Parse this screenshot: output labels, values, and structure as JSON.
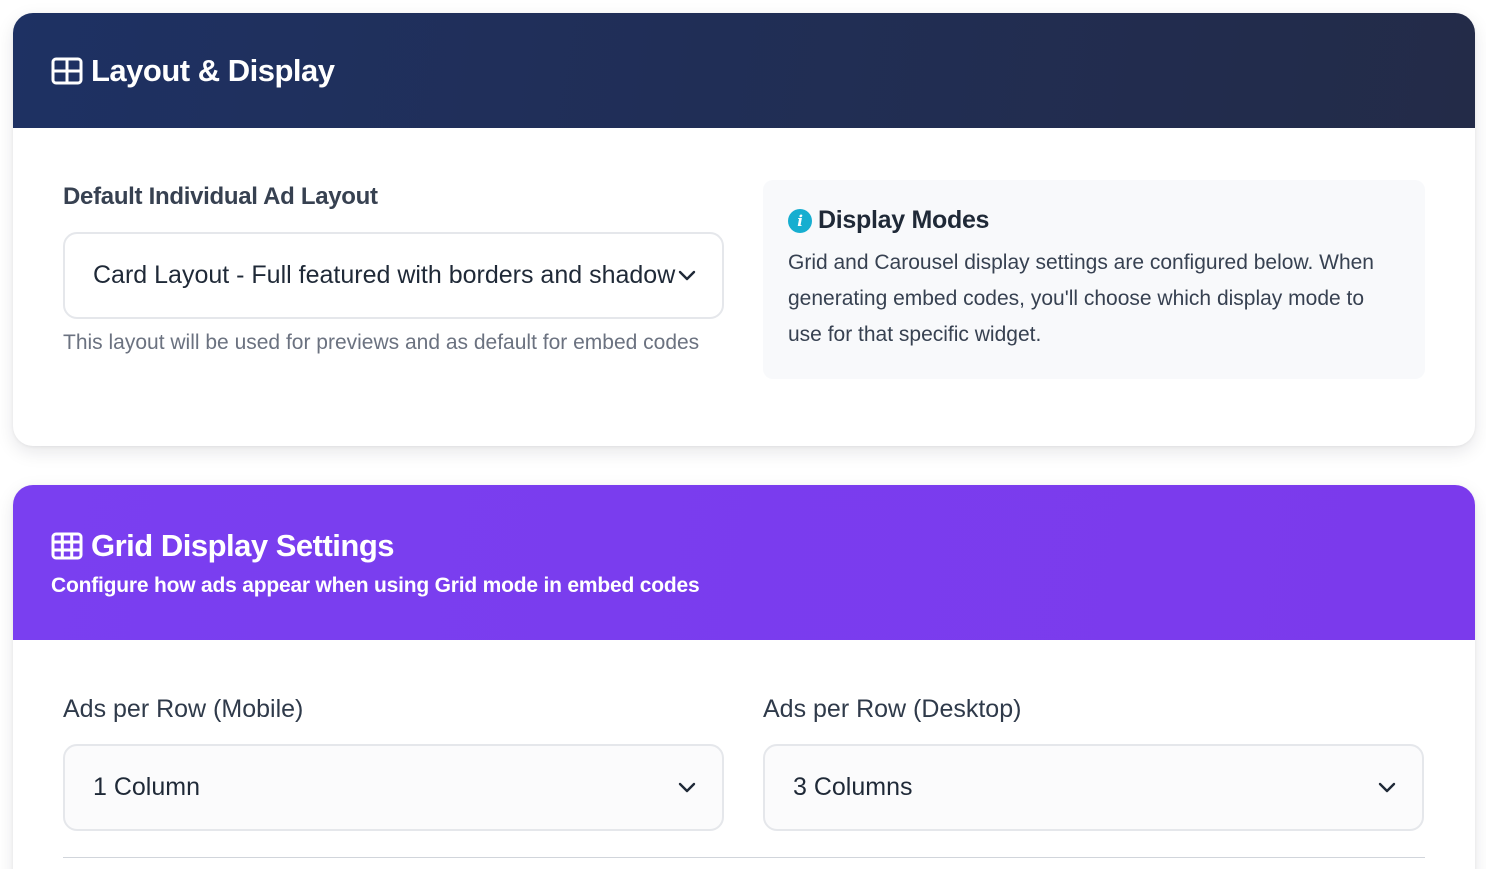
{
  "layout_section": {
    "title": "Layout & Display",
    "icon": "layout-grid-icon",
    "field_label": "Default Individual Ad Layout",
    "select_value": "Card Layout - Full featured with borders and shadow",
    "hint": "This layout will be used for previews and as default for embed codes",
    "info": {
      "icon": "info-icon",
      "title": "Display Modes",
      "text": "Grid and Carousel display settings are configured below. When generating embed codes, you'll choose which display mode to use for that specific widget."
    }
  },
  "grid_section": {
    "title": "Grid Display Settings",
    "icon": "table-grid-icon",
    "subtitle": "Configure how ads appear when using Grid mode in embed codes",
    "mobile": {
      "label": "Ads per Row (Mobile)",
      "value": "1 Column"
    },
    "desktop": {
      "label": "Ads per Row (Desktop)",
      "value": "3 Columns"
    }
  },
  "colors": {
    "header_dark": "#1e3163",
    "header_purple": "#7a3ff0",
    "info_accent": "#16aed0"
  }
}
